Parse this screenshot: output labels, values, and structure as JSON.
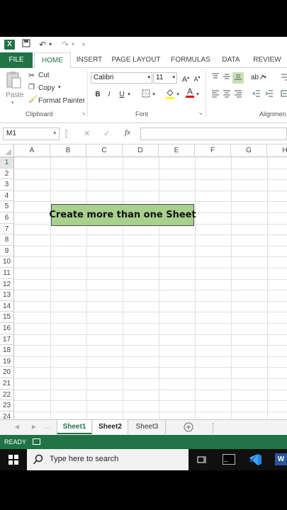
{
  "qat": {
    "title": ""
  },
  "tabs": [
    "FILE",
    "HOME",
    "INSERT",
    "PAGE LAYOUT",
    "FORMULAS",
    "DATA",
    "REVIEW"
  ],
  "ribbon": {
    "paste": "Paste",
    "cut": "Cut",
    "copy": "Copy",
    "format_painter": "Format Painter",
    "clipboard": "Clipboard",
    "font_name": "Calibri",
    "font_size": "11",
    "font_group": "Font",
    "alignment_group": "Alignmen",
    "bold": "B",
    "italic": "I",
    "underline": "U"
  },
  "formula_bar": {
    "name_box": "M1",
    "fx": "fx",
    "cancel": "✕",
    "enter": "✓",
    "value": ""
  },
  "columns": [
    "A",
    "B",
    "C",
    "D",
    "E",
    "F",
    "G",
    "H"
  ],
  "rows": [
    "1",
    "2",
    "3",
    "4",
    "5",
    "6",
    "7",
    "8",
    "9",
    "10",
    "11",
    "12",
    "13",
    "14",
    "15",
    "16",
    "17",
    "18",
    "19",
    "20",
    "21",
    "22",
    "23",
    "24"
  ],
  "textbox": "Create more than one Sheet",
  "sheets": [
    "Sheet1",
    "Sheet2",
    "Sheet3"
  ],
  "status": "READY",
  "taskbar": {
    "search": "Type here to search"
  },
  "colors": {
    "excel_green": "#217346",
    "textbox_fill": "#a9d18e"
  }
}
